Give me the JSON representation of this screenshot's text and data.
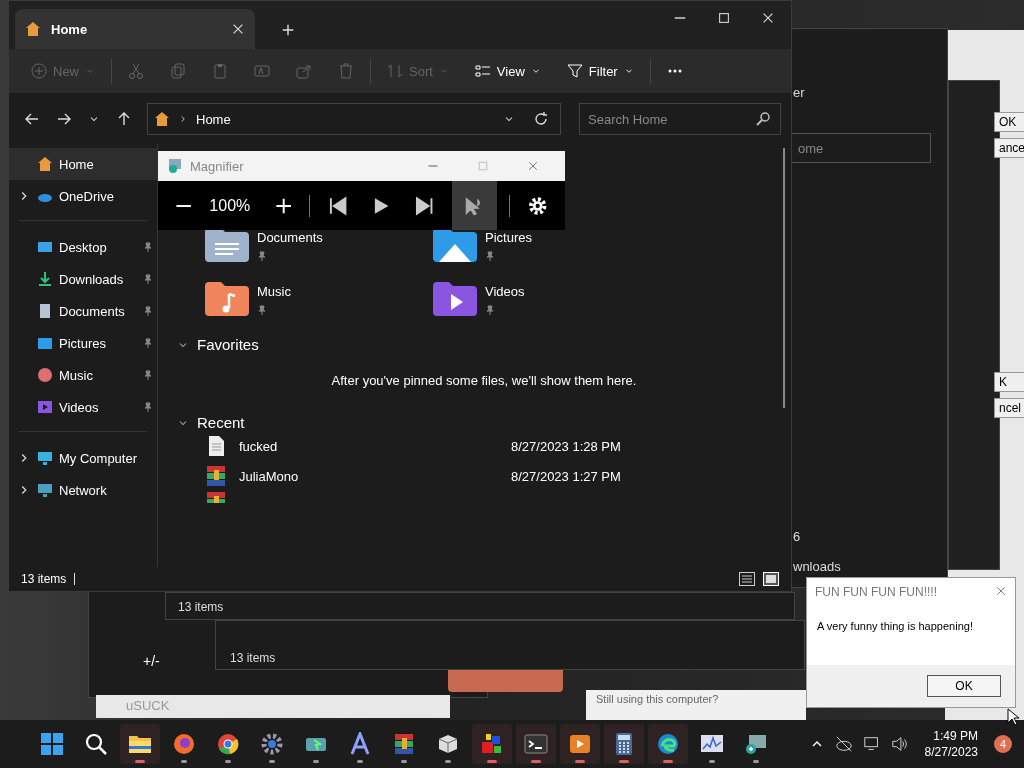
{
  "backdrop": {
    "filter_fragment": "er",
    "search_fragment": "ome",
    "count_fragment": "6",
    "folder_fragment": "wnloads",
    "status_texts": [
      "13 items",
      "13 items"
    ],
    "calculator_key": "+/-",
    "window_title": "uSUCK",
    "prompt": "Still using this computer?",
    "buttons": [
      "OK",
      "ance",
      "K",
      "ncel"
    ]
  },
  "explorer": {
    "tab": {
      "title": "Home",
      "selected": true
    },
    "toolbar": [
      {
        "kind": "new",
        "label": "New",
        "disabled": true
      },
      {
        "kind": "cut",
        "disabled": true
      },
      {
        "kind": "copy",
        "disabled": true
      },
      {
        "kind": "paste",
        "disabled": true
      },
      {
        "kind": "rename",
        "disabled": true
      },
      {
        "kind": "share",
        "disabled": true
      },
      {
        "kind": "delete",
        "disabled": true
      },
      {
        "kind": "sort",
        "label": "Sort",
        "disabled": true
      },
      {
        "kind": "view",
        "label": "View",
        "disabled": false
      },
      {
        "kind": "filter",
        "label": "Filter",
        "disabled": false
      },
      {
        "kind": "more",
        "disabled": false
      }
    ],
    "address": {
      "crumb": "Home"
    },
    "search": {
      "placeholder": "Search Home"
    },
    "sidebar": [
      [
        {
          "label": "Home",
          "kind": "home",
          "selected": true,
          "expandable": false,
          "pinned": false
        },
        {
          "label": "OneDrive",
          "kind": "cloud",
          "selected": false,
          "expandable": true,
          "pinned": false
        }
      ],
      [
        {
          "label": "Desktop",
          "kind": "desktop",
          "selected": false,
          "expandable": false,
          "pinned": true
        },
        {
          "label": "Downloads",
          "kind": "download",
          "selected": false,
          "expandable": false,
          "pinned": true
        },
        {
          "label": "Documents",
          "kind": "document",
          "selected": false,
          "expandable": false,
          "pinned": true
        },
        {
          "label": "Pictures",
          "kind": "picture",
          "selected": false,
          "expandable": false,
          "pinned": true
        },
        {
          "label": "Music",
          "kind": "music",
          "selected": false,
          "expandable": false,
          "pinned": true
        },
        {
          "label": "Videos",
          "kind": "video",
          "selected": false,
          "expandable": false,
          "pinned": true
        }
      ],
      [
        {
          "label": "My Computer",
          "kind": "computer",
          "selected": false,
          "expandable": true,
          "pinned": false
        },
        {
          "label": "Network",
          "kind": "network",
          "selected": false,
          "expandable": true,
          "pinned": false
        }
      ]
    ],
    "quick_access": [
      {
        "name": "Documents",
        "kind": "document",
        "pinned": true
      },
      {
        "name": "Pictures",
        "kind": "picture",
        "pinned": true
      },
      {
        "name": "Music",
        "kind": "music",
        "pinned": true
      },
      {
        "name": "Videos",
        "kind": "video",
        "pinned": true
      }
    ],
    "favorites": {
      "title": "Favorites",
      "expanded": true,
      "message": "After you've pinned some files, we'll show them here."
    },
    "recent": {
      "title": "Recent",
      "expanded": true,
      "files": [
        {
          "name": "fucked",
          "kind": "text",
          "modified": "8/27/2023 1:28 PM"
        },
        {
          "name": "JuliaMono",
          "kind": "archive",
          "modified": "8/27/2023 1:27 PM"
        }
      ]
    },
    "status": "13 items",
    "view_modes": [
      {
        "kind": "details",
        "selected": false
      },
      {
        "kind": "tiles",
        "selected": true
      }
    ]
  },
  "magnifier": {
    "title": "Magnifier",
    "zoom": "100%",
    "read_from_pointer_on": true
  },
  "dialog": {
    "title": "FUN FUN FUN FUN!!!!",
    "message": "A very funny thing is happening!",
    "button": "OK"
  },
  "taskbar": {
    "apps": [
      {
        "kind": "start",
        "active": false,
        "running": false
      },
      {
        "kind": "search",
        "active": false,
        "running": false
      },
      {
        "kind": "folder",
        "active": true,
        "running": true
      },
      {
        "kind": "firefox",
        "active": false,
        "running": true
      },
      {
        "kind": "chrome",
        "active": false,
        "running": true
      },
      {
        "kind": "gear",
        "active": false,
        "running": true
      },
      {
        "kind": "sync",
        "active": false,
        "running": true
      },
      {
        "kind": "font",
        "active": false,
        "running": true
      },
      {
        "kind": "archive",
        "active": false,
        "running": true
      },
      {
        "kind": "cube",
        "active": false,
        "running": true
      },
      {
        "kind": "blocks",
        "active": true,
        "running": true
      },
      {
        "kind": "terminal",
        "active": true,
        "running": true
      },
      {
        "kind": "player",
        "active": true,
        "running": true
      },
      {
        "kind": "calculator",
        "active": true,
        "running": true
      },
      {
        "kind": "edge",
        "active": true,
        "running": true
      },
      {
        "kind": "chart",
        "active": false,
        "running": true
      },
      {
        "kind": "magnifier",
        "active": false,
        "running": true
      }
    ],
    "time": "1:49 PM",
    "date": "8/27/2023",
    "badge": "4"
  }
}
